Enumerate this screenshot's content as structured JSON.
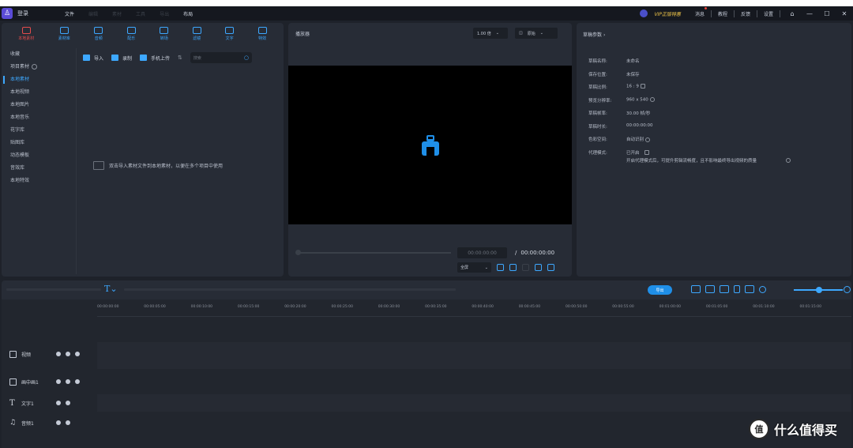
{
  "titlebar": {
    "login": "登录",
    "menu": [
      "文件",
      "编辑",
      "素材",
      "工具",
      "导出",
      "布局"
    ],
    "vip": "VIP正版特惠",
    "message": "消息",
    "tutorial": "教程",
    "feedback": "反馈",
    "settings": "设置"
  },
  "media": {
    "tabs": [
      "本地素材",
      "素材库",
      "音频",
      "配乐",
      "转场",
      "滤镜",
      "文字",
      "特效"
    ],
    "categories": [
      "收藏",
      "项目素材",
      "本地素材",
      "本地视频",
      "本地图片",
      "本地音乐",
      "花字库",
      "贴图库",
      "动态模板",
      "音效库",
      "本地特效"
    ],
    "tools": {
      "import": "导入",
      "record": "录制",
      "phone_upload": "手机上传"
    },
    "search_placeholder": "搜索",
    "empty_hint": "双击导入素材文件到本地素材，以便在多个项目中使用"
  },
  "player": {
    "title": "播放器",
    "zoom": "1.00 倍",
    "quality": "原始",
    "current_time": "00:00:00:00",
    "total_time": "00:00:00:00",
    "ratio": "全屏",
    "progress": 0
  },
  "props": {
    "title": "草稿参数",
    "rows": [
      {
        "k": "草稿名称:",
        "v": "未命名"
      },
      {
        "k": "保存位置:",
        "v": "未保存"
      },
      {
        "k": "草稿比例:",
        "v": "16 : 9"
      },
      {
        "k": "预览分辨率:",
        "v": "960 x 540"
      },
      {
        "k": "草稿帧率:",
        "v": "30.00 帧/秒"
      },
      {
        "k": "草稿时长:",
        "v": "00:00:00:00"
      },
      {
        "k": "色彩空间:",
        "v": "自动识别"
      },
      {
        "k": "代理模式:",
        "v": "已开启"
      }
    ],
    "proxy_note": "开启代理模式后，可提升剪辑流畅度，且不影响最终导出视频的质量"
  },
  "timeline": {
    "export_label": "导出",
    "ruler": [
      "00:00:00:00",
      "00:00:05:00",
      "00:00:10:00",
      "00:00:15:00",
      "00:00:20:00",
      "00:00:25:00",
      "00:00:30:00",
      "00:00:35:00",
      "00:00:40:00",
      "00:00:45:00",
      "00:00:50:00",
      "00:00:55:00",
      "00:01:00:00",
      "00:01:05:00",
      "00:01:10:00",
      "00:01:15:00"
    ],
    "tracks": [
      {
        "name": "视频",
        "icon": "video-track-icon"
      },
      {
        "name": "画中画1",
        "icon": "pip-track-icon"
      },
      {
        "name": "文字1",
        "icon": "text-track-icon"
      },
      {
        "name": "音频1",
        "icon": "audio-track-icon"
      }
    ]
  },
  "watermark": {
    "logo": "值",
    "text": "什么值得买"
  },
  "colors": {
    "accent": "#3da8ff",
    "active_tab": "#e44c4c",
    "vip": "#f5c94a",
    "export": "#1f8fe8",
    "background": "#1e222a",
    "panel": "#272c36"
  }
}
